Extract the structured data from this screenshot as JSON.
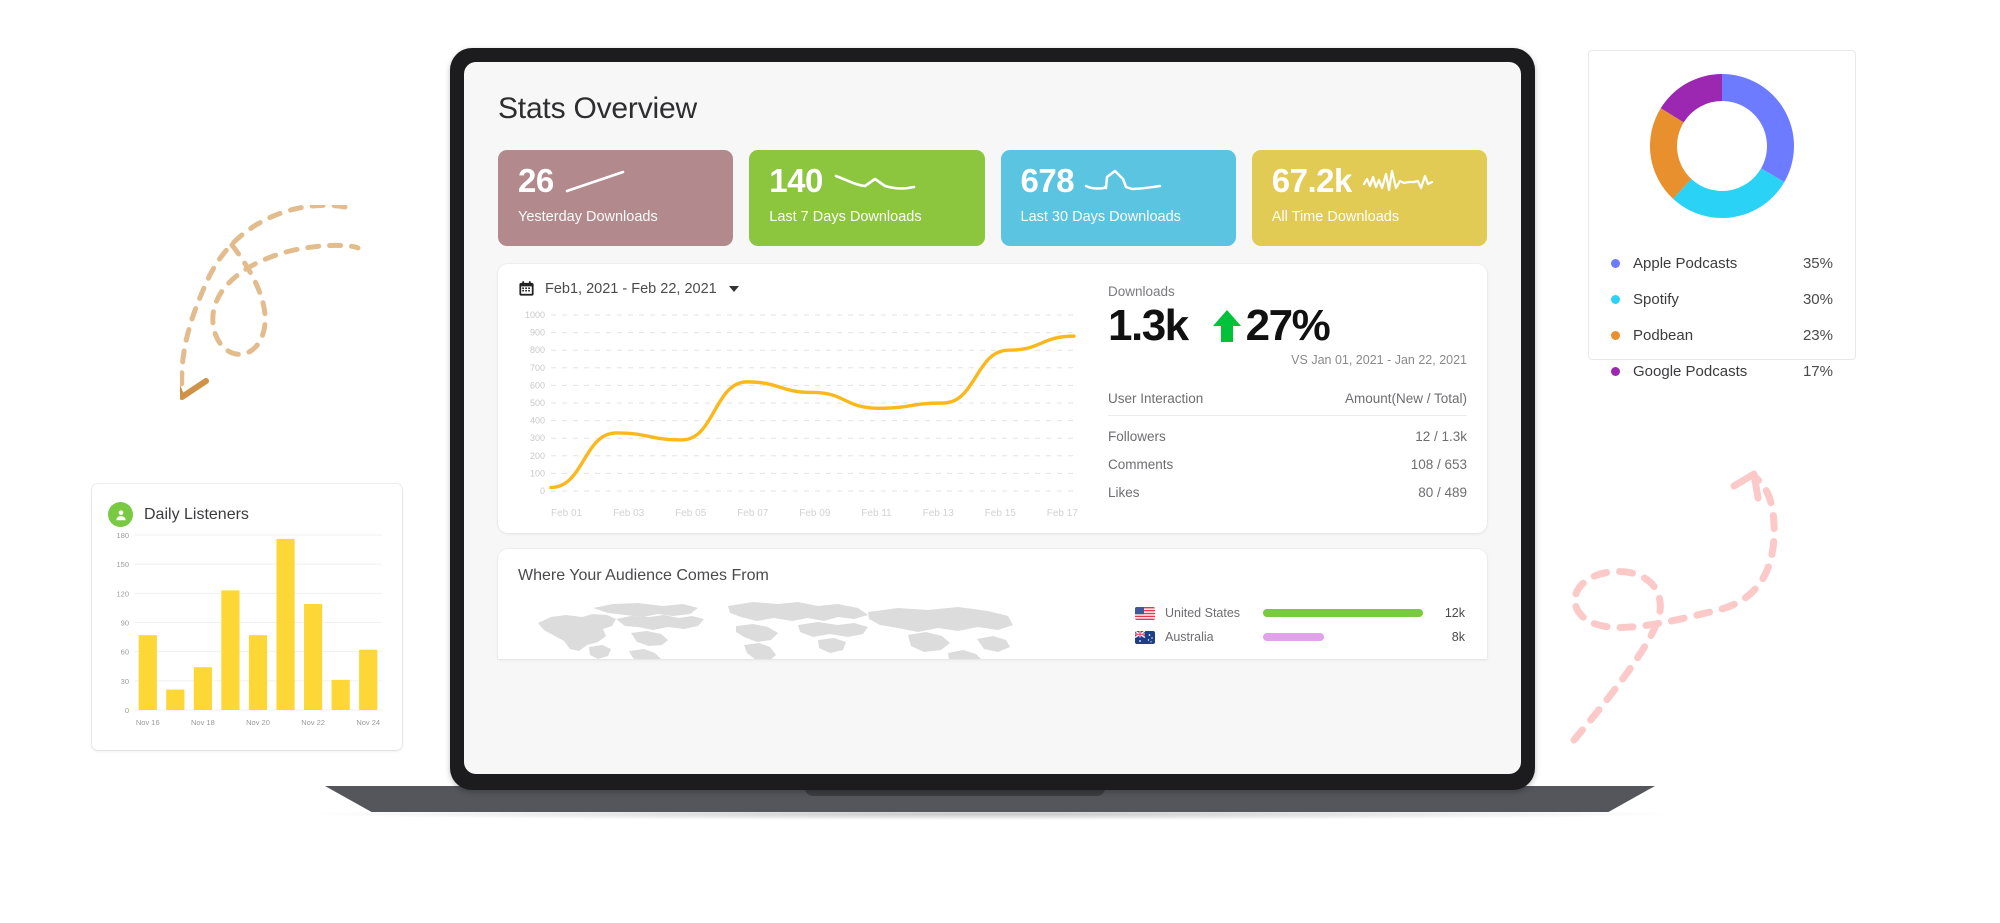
{
  "page": {
    "title": "Stats Overview"
  },
  "stat_cards": [
    {
      "value": "26",
      "label": "Yesterday Downloads",
      "color": "#b2898c",
      "spark": "rising-line-icon"
    },
    {
      "value": "140",
      "label": "Last 7 Days Downloads",
      "color": "#8cc63f",
      "spark": "wavy-line-icon"
    },
    {
      "value": "678",
      "label": "Last 30 Days Downloads",
      "color": "#5bc4e0",
      "spark": "peak-line-icon"
    },
    {
      "value": "67.2k",
      "label": "All Time Downloads",
      "color": "#e2cb55",
      "spark": "noisy-line-icon"
    }
  ],
  "date_picker": {
    "icon": "calendar-icon",
    "value": "Feb1, 2021 - Feb 22, 2021",
    "caret": "chevron-down-icon"
  },
  "downloads": {
    "label": "Downloads",
    "value": "1.3k",
    "change_arrow": "arrow-up-icon",
    "change_pct": "27%",
    "change_color": "#00c23a",
    "comparison": "VS Jan 01, 2021 - Jan 22, 2021"
  },
  "user_interaction": {
    "col_metric": "User Interaction",
    "col_amount": "Amount(New / Total)",
    "rows": [
      {
        "metric": "Followers",
        "amount": "12 / 1.3k"
      },
      {
        "metric": "Comments",
        "amount": "108 / 653"
      },
      {
        "metric": "Likes",
        "amount": "80 / 489"
      }
    ]
  },
  "audience": {
    "title": "Where Your Audience Comes From",
    "map": "world-map-icon",
    "countries": [
      {
        "flag": "flag-us-icon",
        "name": "United States",
        "value": "12k",
        "pct": 100,
        "color": "#7ac943"
      },
      {
        "flag": "flag-au-icon",
        "name": "Australia",
        "value": "8k",
        "pct": 38,
        "color": "#e0a3ea"
      }
    ]
  },
  "daily_listeners": {
    "title": "Daily Listeners",
    "icon": "person-icon"
  },
  "platforms": {
    "legend": [
      {
        "name": "Apple Podcasts",
        "value": "35%",
        "color": "#6c7bff"
      },
      {
        "name": "Spotify",
        "value": "30%",
        "color": "#2ad2f5"
      },
      {
        "name": "Podbean",
        "value": "23%",
        "color": "#e8902e"
      },
      {
        "name": "Google Podcasts",
        "value": "17%",
        "color": "#9c27b0"
      }
    ]
  },
  "chart_data": [
    {
      "type": "line",
      "title": "Downloads",
      "xlabel": "",
      "ylabel": "",
      "ylim": [
        0,
        1000
      ],
      "yticks": [
        0,
        100,
        200,
        300,
        400,
        500,
        600,
        700,
        800,
        900,
        1000
      ],
      "xticks": [
        "Feb 01",
        "Feb 03",
        "Feb 05",
        "Feb 07",
        "Feb 09",
        "Feb 11",
        "Feb 13",
        "Feb 15",
        "Feb 17"
      ],
      "grid": true,
      "legend": "none",
      "color": "#fbb81c",
      "x": [
        "Feb 01",
        "Feb 03",
        "Feb 05",
        "Feb 07",
        "Feb 09",
        "Feb 11",
        "Feb 13",
        "Feb 15",
        "Feb 17"
      ],
      "values": [
        20,
        330,
        290,
        620,
        560,
        470,
        500,
        800,
        880
      ]
    },
    {
      "type": "bar",
      "title": "Daily Listeners",
      "xlabel": "",
      "ylabel": "",
      "ylim": [
        0,
        180
      ],
      "yticks": [
        0,
        30,
        60,
        90,
        120,
        150,
        180
      ],
      "categories": [
        "Nov 16",
        "",
        "Nov 18",
        "",
        "Nov 20",
        "",
        "Nov 22",
        "",
        "Nov 24"
      ],
      "xticks": [
        "Nov 16",
        "Nov 18",
        "Nov 20",
        "Nov 22",
        "Nov 24"
      ],
      "values": [
        77,
        21,
        44,
        123,
        77,
        176,
        109,
        31,
        62
      ],
      "color": "#fcd735",
      "grid": true,
      "legend": "none"
    },
    {
      "type": "pie",
      "title": "",
      "labels": [
        "Apple Podcasts",
        "Spotify",
        "Podbean",
        "Google Podcasts"
      ],
      "values": [
        35,
        30,
        23,
        17
      ],
      "colors": [
        "#6c7bff",
        "#2ad2f5",
        "#e8902e",
        "#9c27b0"
      ],
      "donut": true,
      "legend": "bottom"
    },
    {
      "type": "bar",
      "title": "Where Your Audience Comes From",
      "orientation": "horizontal",
      "categories": [
        "United States",
        "Australia"
      ],
      "values": [
        12000,
        8000
      ],
      "value_labels": [
        "12k",
        "8k"
      ],
      "colors": [
        "#7ac943",
        "#e0a3ea"
      ],
      "legend": "none",
      "grid": false
    }
  ]
}
